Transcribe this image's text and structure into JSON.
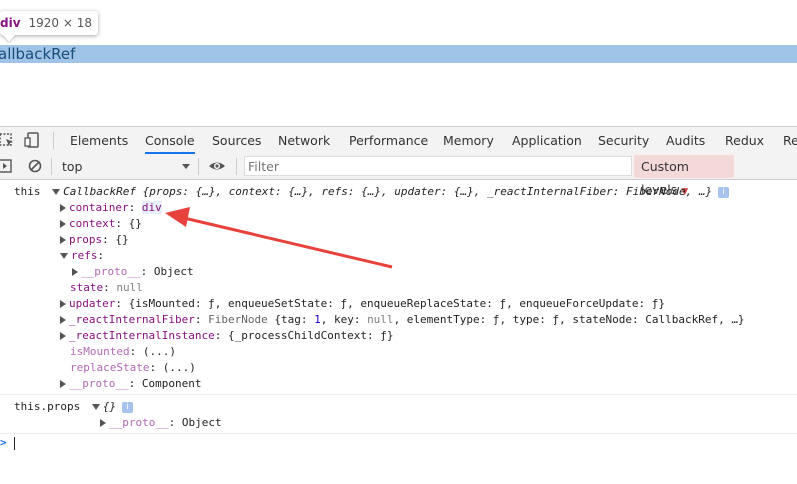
{
  "preview": {
    "tooltip_tag": "div",
    "tooltip_size": "1920 × 18",
    "highlight_text": "allbackRef"
  },
  "tabs": {
    "items": [
      "Elements",
      "Console",
      "Sources",
      "Network",
      "Performance",
      "Memory",
      "Application",
      "Security",
      "Audits",
      "Redux",
      "Re"
    ],
    "active": "Console"
  },
  "toolbar": {
    "context": "top",
    "filter_placeholder": "Filter",
    "levels_label": "Custom levels"
  },
  "console": {
    "this_label": "this",
    "this_summary": "CallbackRef {props: {…}, context: {…}, refs: {…}, updater: {…}, _reactInternalFiber: FiberNode, …}",
    "container_key": "container",
    "container_val": "div",
    "context_key": "context",
    "context_val": "{}",
    "props_key": "props",
    "props_val": "{}",
    "refs_key": "refs",
    "proto_key": "__proto__",
    "proto_val": "Object",
    "state_key": "state",
    "state_val": "null",
    "updater_key": "updater",
    "updater_val": "{isMounted: ƒ, enqueueSetState: ƒ, enqueueReplaceState: ƒ, enqueueForceUpdate: ƒ}",
    "fiber_key": "_reactInternalFiber",
    "fiber_type": "FiberNode",
    "fiber_val_1": "{tag: ",
    "fiber_tag": "1",
    "fiber_val_2": ", key: ",
    "fiber_key_null": "null",
    "fiber_val_3": ", elementType: ƒ, type: ƒ, stateNode: CallbackRef, …}",
    "instance_key": "_reactInternalInstance",
    "instance_val": "{_processChildContext: ƒ}",
    "ismounted_key": "isMounted",
    "ismounted_val": "(...)",
    "replacestate_key": "replaceState",
    "replacestate_val": "(...)",
    "proto2_val": "Component",
    "props_label": "this.props",
    "props_summary": "{}",
    "props_proto_val": "Object",
    "info_glyph": "i",
    "prompt_glyph": ">"
  },
  "colors": {
    "annotation_arrow": "#e8423c"
  }
}
